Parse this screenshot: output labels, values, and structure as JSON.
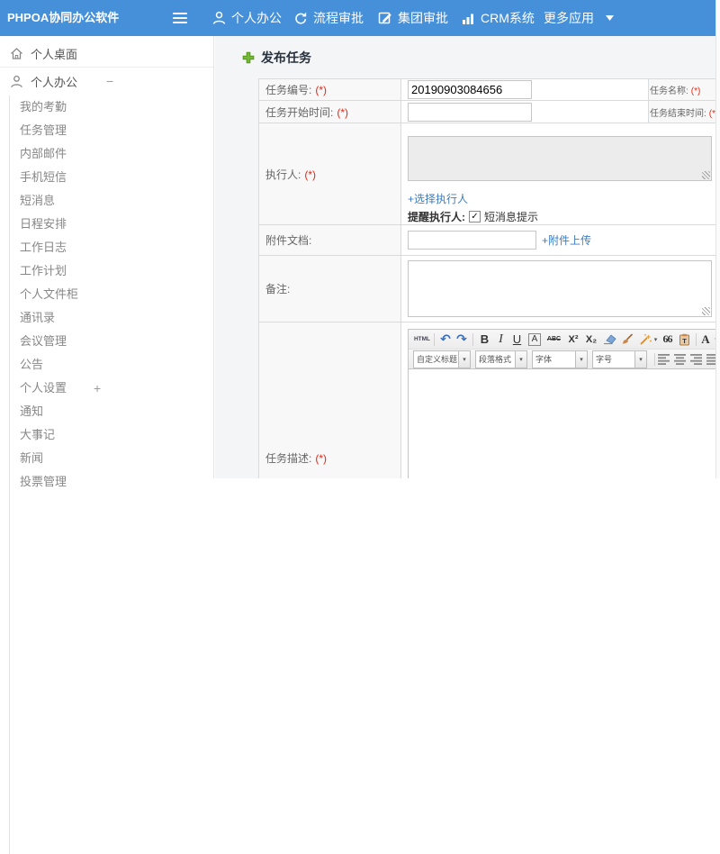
{
  "topbar": {
    "logo": "PHPOA协同办公软件",
    "nav_personal": "个人办公",
    "nav_flow": "流程审批",
    "nav_group": "集团审批",
    "nav_crm": "CRM系统",
    "nav_more": "更多应用"
  },
  "sidebar": {
    "desktop": "个人桌面",
    "office": "个人办公",
    "office_toggle": "−",
    "settings_toggle": "+",
    "submenu": [
      {
        "label": "我的考勤"
      },
      {
        "label": "任务管理"
      },
      {
        "label": "内部邮件"
      },
      {
        "label": "手机短信"
      },
      {
        "label": "短消息"
      },
      {
        "label": "日程安排"
      },
      {
        "label": "工作日志"
      },
      {
        "label": "工作计划"
      },
      {
        "label": "个人文件柜"
      },
      {
        "label": "通讯录"
      },
      {
        "label": "会议管理"
      },
      {
        "label": "公告"
      },
      {
        "label": "个人设置"
      },
      {
        "label": "通知"
      },
      {
        "label": "大事记"
      },
      {
        "label": "新闻"
      },
      {
        "label": "投票管理"
      }
    ]
  },
  "form": {
    "title": "发布任务",
    "task_no_label": "任务编号:",
    "task_no_req": "(*)",
    "task_no_value": "20190903084656",
    "task_name_label": "任务名称:",
    "task_name_req": "(*)",
    "start_label": "任务开始时间:",
    "start_req": "(*)",
    "end_label": "任务结束时间:",
    "end_req": "(*)",
    "executor_label": "执行人:",
    "executor_req": "(*)",
    "choose_link": "+选择执行人",
    "remind_label": "提醒执行人:",
    "sms_label": "短消息提示",
    "checkbox_checked": "✓",
    "attach_label": "附件文档:",
    "upload_link": "+附件上传",
    "note_label": "备注:",
    "desc_label": "任务描述:",
    "desc_req": "(*)"
  },
  "editor": {
    "html_btn": "HTML",
    "bold": "B",
    "italic": "I",
    "underline": "U",
    "fontbox": "A",
    "strike": "ABC",
    "sup": "X²",
    "sub": "X₂",
    "quote": "66",
    "color_a": "A",
    "combo_title": "自定义标题",
    "combo_para": "段落格式",
    "combo_font": "字体",
    "combo_size": "字号"
  }
}
